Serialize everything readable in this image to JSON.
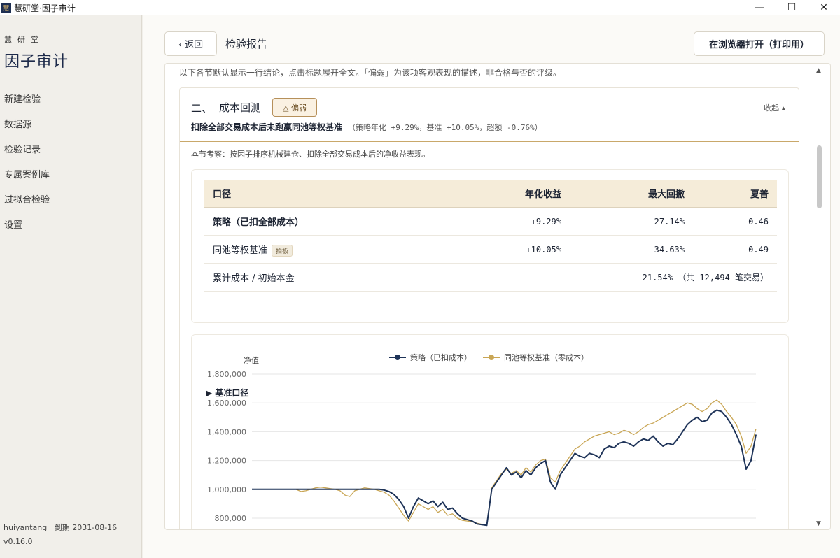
{
  "window": {
    "title": "慧研堂·因子审计",
    "app_icon": "慧",
    "minimize": "—",
    "maximize": "☐",
    "close": "✕"
  },
  "sidebar": {
    "brand_small": "慧研堂",
    "brand_big": "因子审计",
    "items": [
      {
        "label": "新建检验"
      },
      {
        "label": "数据源"
      },
      {
        "label": "检验记录"
      },
      {
        "label": "专属案例库"
      },
      {
        "label": "过拟合检验"
      },
      {
        "label": "设置"
      }
    ],
    "user": "huiyantang",
    "expiry": "到期 2031-08-16",
    "version": "v0.16.0"
  },
  "header": {
    "back_label": "‹ 返回",
    "title": "检验报告",
    "open_browser_label": "在浏览器打开（打印用）"
  },
  "intro": "以下各节默认显示一行结论，点击标题展开全文。「偏弱」为该项客观表现的描述，非合格与否的评级。",
  "section": {
    "number": "二、",
    "title": "成本回测",
    "badge": "△ 偏弱",
    "collapse": "收起 ▴",
    "summary_bold": "扣除全部交易成本后未跑赢同池等权基准",
    "summary_nums": "（策略年化 +9.29%，基准 +10.05%，超额 -0.76%）",
    "description": "本节考察：按因子排序机械建仓、扣除全部交易成本后的净收益表现。"
  },
  "table": {
    "headers": [
      "口径",
      "年化收益",
      "最大回撤",
      "夏普"
    ],
    "rows": [
      {
        "name": "策略（已扣全部成本）",
        "annual": "+9.29%",
        "drawdown": "-27.14%",
        "sharpe": "0.46"
      },
      {
        "name": "同池等权基准",
        "tag": "拍板",
        "annual": "+10.05%",
        "drawdown": "-34.63%",
        "sharpe": "0.49"
      }
    ],
    "cost_label": "累计成本 / 初始本金",
    "cost_value": "21.54% （共 12,494 笔交易）",
    "bench_toggle": "▶ 基准口径"
  },
  "colors": {
    "strategy": "#1e3358",
    "benchmark": "#c9a655",
    "accent": "#c9a86a"
  },
  "chart_data": {
    "type": "line",
    "ylabel": "净值",
    "yticks": [
      "1,800,000",
      "1,600,000",
      "1,400,000",
      "1,200,000",
      "1,000,000",
      "800,000"
    ],
    "ylim": [
      700000,
      1800000
    ],
    "legend_position": "top-center",
    "series": [
      {
        "name": "策略（已扣成本）",
        "color": "#1e3358",
        "values": [
          1000000,
          1000000,
          1000000,
          1000000,
          1000000,
          1000000,
          1000000,
          1000000,
          1000000,
          1000000,
          1000000,
          1000000,
          1000000,
          1000000,
          1000000,
          1000000,
          1000000,
          1000000,
          1000000,
          1000000,
          1000000,
          1000000,
          1000000,
          1000000,
          1000000,
          1000000,
          1000000,
          995000,
          985000,
          965000,
          930000,
          880000,
          800000,
          880000,
          940000,
          920000,
          900000,
          920000,
          880000,
          910000,
          860000,
          870000,
          830000,
          800000,
          790000,
          780000,
          760000,
          755000,
          750000,
          1000000,
          1050000,
          1100000,
          1150000,
          1100000,
          1120000,
          1080000,
          1130000,
          1100000,
          1150000,
          1180000,
          1200000,
          1050000,
          1000000,
          1100000,
          1150000,
          1200000,
          1250000,
          1230000,
          1220000,
          1250000,
          1240000,
          1220000,
          1280000,
          1300000,
          1290000,
          1320000,
          1330000,
          1320000,
          1300000,
          1330000,
          1350000,
          1340000,
          1370000,
          1330000,
          1300000,
          1320000,
          1310000,
          1350000,
          1400000,
          1450000,
          1480000,
          1500000,
          1470000,
          1480000,
          1530000,
          1550000,
          1540000,
          1500000,
          1450000,
          1380000,
          1300000,
          1140000,
          1200000,
          1380000
        ]
      },
      {
        "name": "同池等权基准（零成本）",
        "color": "#c9a655",
        "values": [
          1000000,
          1000000,
          1000000,
          1000000,
          1000000,
          1000000,
          1000000,
          1000000,
          1000000,
          1000000,
          985000,
          990000,
          1000000,
          1010000,
          1015000,
          1010000,
          1005000,
          1000000,
          990000,
          960000,
          950000,
          990000,
          1000000,
          1010000,
          1005000,
          1000000,
          990000,
          980000,
          960000,
          920000,
          870000,
          820000,
          780000,
          840000,
          900000,
          880000,
          860000,
          880000,
          840000,
          860000,
          820000,
          830000,
          800000,
          785000,
          780000,
          775000,
          765000,
          758000,
          752000,
          1010000,
          1060000,
          1110000,
          1140000,
          1110000,
          1130000,
          1100000,
          1150000,
          1120000,
          1170000,
          1200000,
          1210000,
          1080000,
          1050000,
          1130000,
          1180000,
          1230000,
          1280000,
          1300000,
          1330000,
          1350000,
          1370000,
          1380000,
          1390000,
          1400000,
          1380000,
          1390000,
          1410000,
          1400000,
          1380000,
          1400000,
          1430000,
          1450000,
          1460000,
          1480000,
          1500000,
          1520000,
          1540000,
          1560000,
          1580000,
          1600000,
          1590000,
          1560000,
          1540000,
          1560000,
          1600000,
          1620000,
          1590000,
          1540000,
          1500000,
          1450000,
          1370000,
          1250000,
          1300000,
          1420000
        ]
      }
    ]
  }
}
